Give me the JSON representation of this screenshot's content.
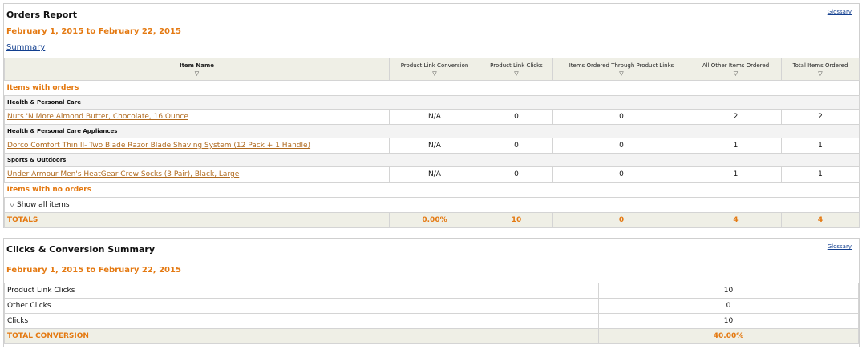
{
  "orders_report": {
    "title": "Orders Report",
    "glossary": "Glossary",
    "date_range": "February 1, 2015 to February 22, 2015",
    "summary_link": "Summary",
    "columns": [
      "Item Name",
      "Product Link Conversion",
      "Product Link Clicks",
      "Items Ordered Through Product Links",
      "All Other Items Ordered",
      "Total Items Ordered"
    ],
    "sort_arrow": "▽",
    "section_with_orders": "Items with orders",
    "categories": [
      {
        "name": "Health & Personal Care",
        "item": {
          "name": "Nuts 'N More Almond Butter, Chocolate, 16 Ounce",
          "conversion": "N/A",
          "clicks": "0",
          "ordered_links": "0",
          "other": "2",
          "total": "2"
        }
      },
      {
        "name": "Health & Personal Care Appliances",
        "item": {
          "name": "Dorco Comfort Thin II- Two Blade Razor Blade Shaving System (12 Pack + 1 Handle)",
          "conversion": "N/A",
          "clicks": "0",
          "ordered_links": "0",
          "other": "1",
          "total": "1"
        }
      },
      {
        "name": "Sports & Outdoors",
        "item": {
          "name": "Under Armour Men's HeatGear Crew Socks (3 Pair), Black, Large",
          "conversion": "N/A",
          "clicks": "0",
          "ordered_links": "0",
          "other": "1",
          "total": "1"
        }
      }
    ],
    "section_no_orders": "Items with no orders",
    "show_all": "Show all items",
    "totals": {
      "label": "TOTALS",
      "conversion": "0.00%",
      "clicks": "10",
      "ordered_links": "0",
      "other": "4",
      "total": "4"
    }
  },
  "clicks_summary": {
    "title": "Clicks & Conversion Summary",
    "glossary": "Glossary",
    "date_range": "February 1, 2015 to February 22, 2015",
    "rows": [
      {
        "label": "Product Link Clicks",
        "value": "10"
      },
      {
        "label": "Other Clicks",
        "value": "0"
      },
      {
        "label": "Clicks",
        "value": "10"
      }
    ],
    "total": {
      "label": "TOTAL CONVERSION",
      "value": "40.00%"
    }
  },
  "colors": {
    "accent": "#e47911",
    "link": "#123f8f",
    "header_bg": "#efefe6"
  }
}
